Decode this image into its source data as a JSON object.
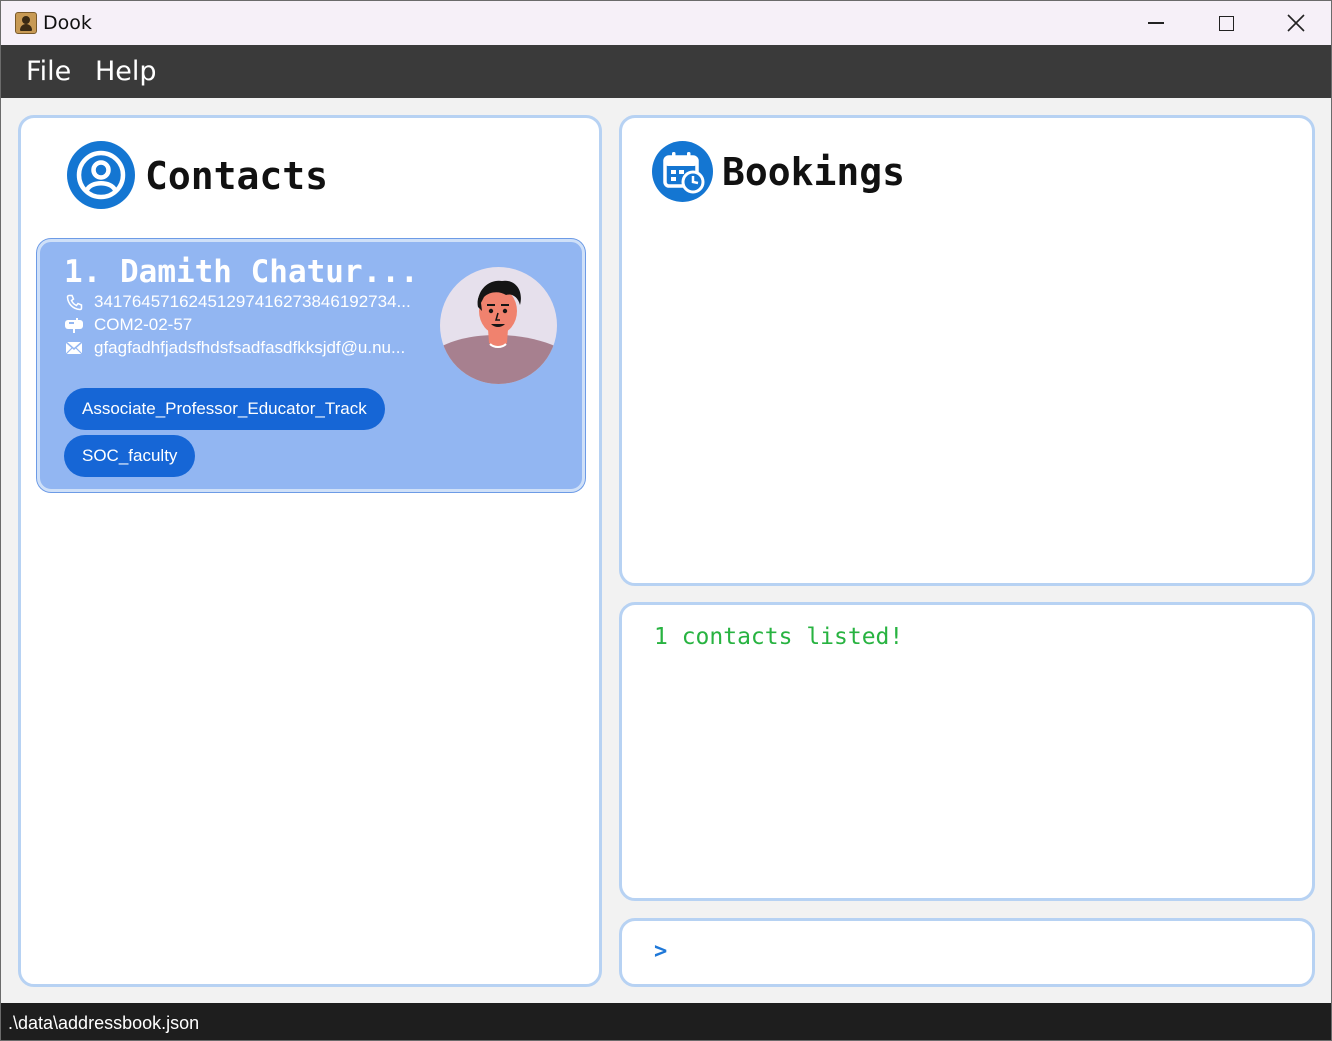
{
  "window": {
    "title": "Dook"
  },
  "menu": {
    "file": "File",
    "help": "Help"
  },
  "contacts_panel": {
    "title": "Contacts",
    "icon": "person-circle-icon",
    "cards": [
      {
        "index_name": "1.  Damith Chatur...",
        "phone": "34176457162451297416273846192734...",
        "address": "COM2-02-57",
        "email": "gfagfadhfjadsfhdsfsadfasdfkksjdf@u.nu...",
        "tags": [
          "Associate_Professor_Educator_Track",
          "SOC_faculty"
        ]
      }
    ]
  },
  "bookings_panel": {
    "title": "Bookings",
    "icon": "calendar-clock-icon"
  },
  "result_panel": {
    "message": "1 contacts listed!"
  },
  "command_panel": {
    "prompt": ">",
    "value": ""
  },
  "status_bar": {
    "path": ".\\data\\addressbook.json"
  },
  "colors": {
    "accent": "#1476d2",
    "card_bg": "#92b6f2",
    "tag_bg": "#1666d6",
    "panel_border": "#b7d2f3",
    "result_text": "#28b341",
    "menubar_bg": "#3a3a3a",
    "statusbar_bg": "#1e1e1e"
  }
}
